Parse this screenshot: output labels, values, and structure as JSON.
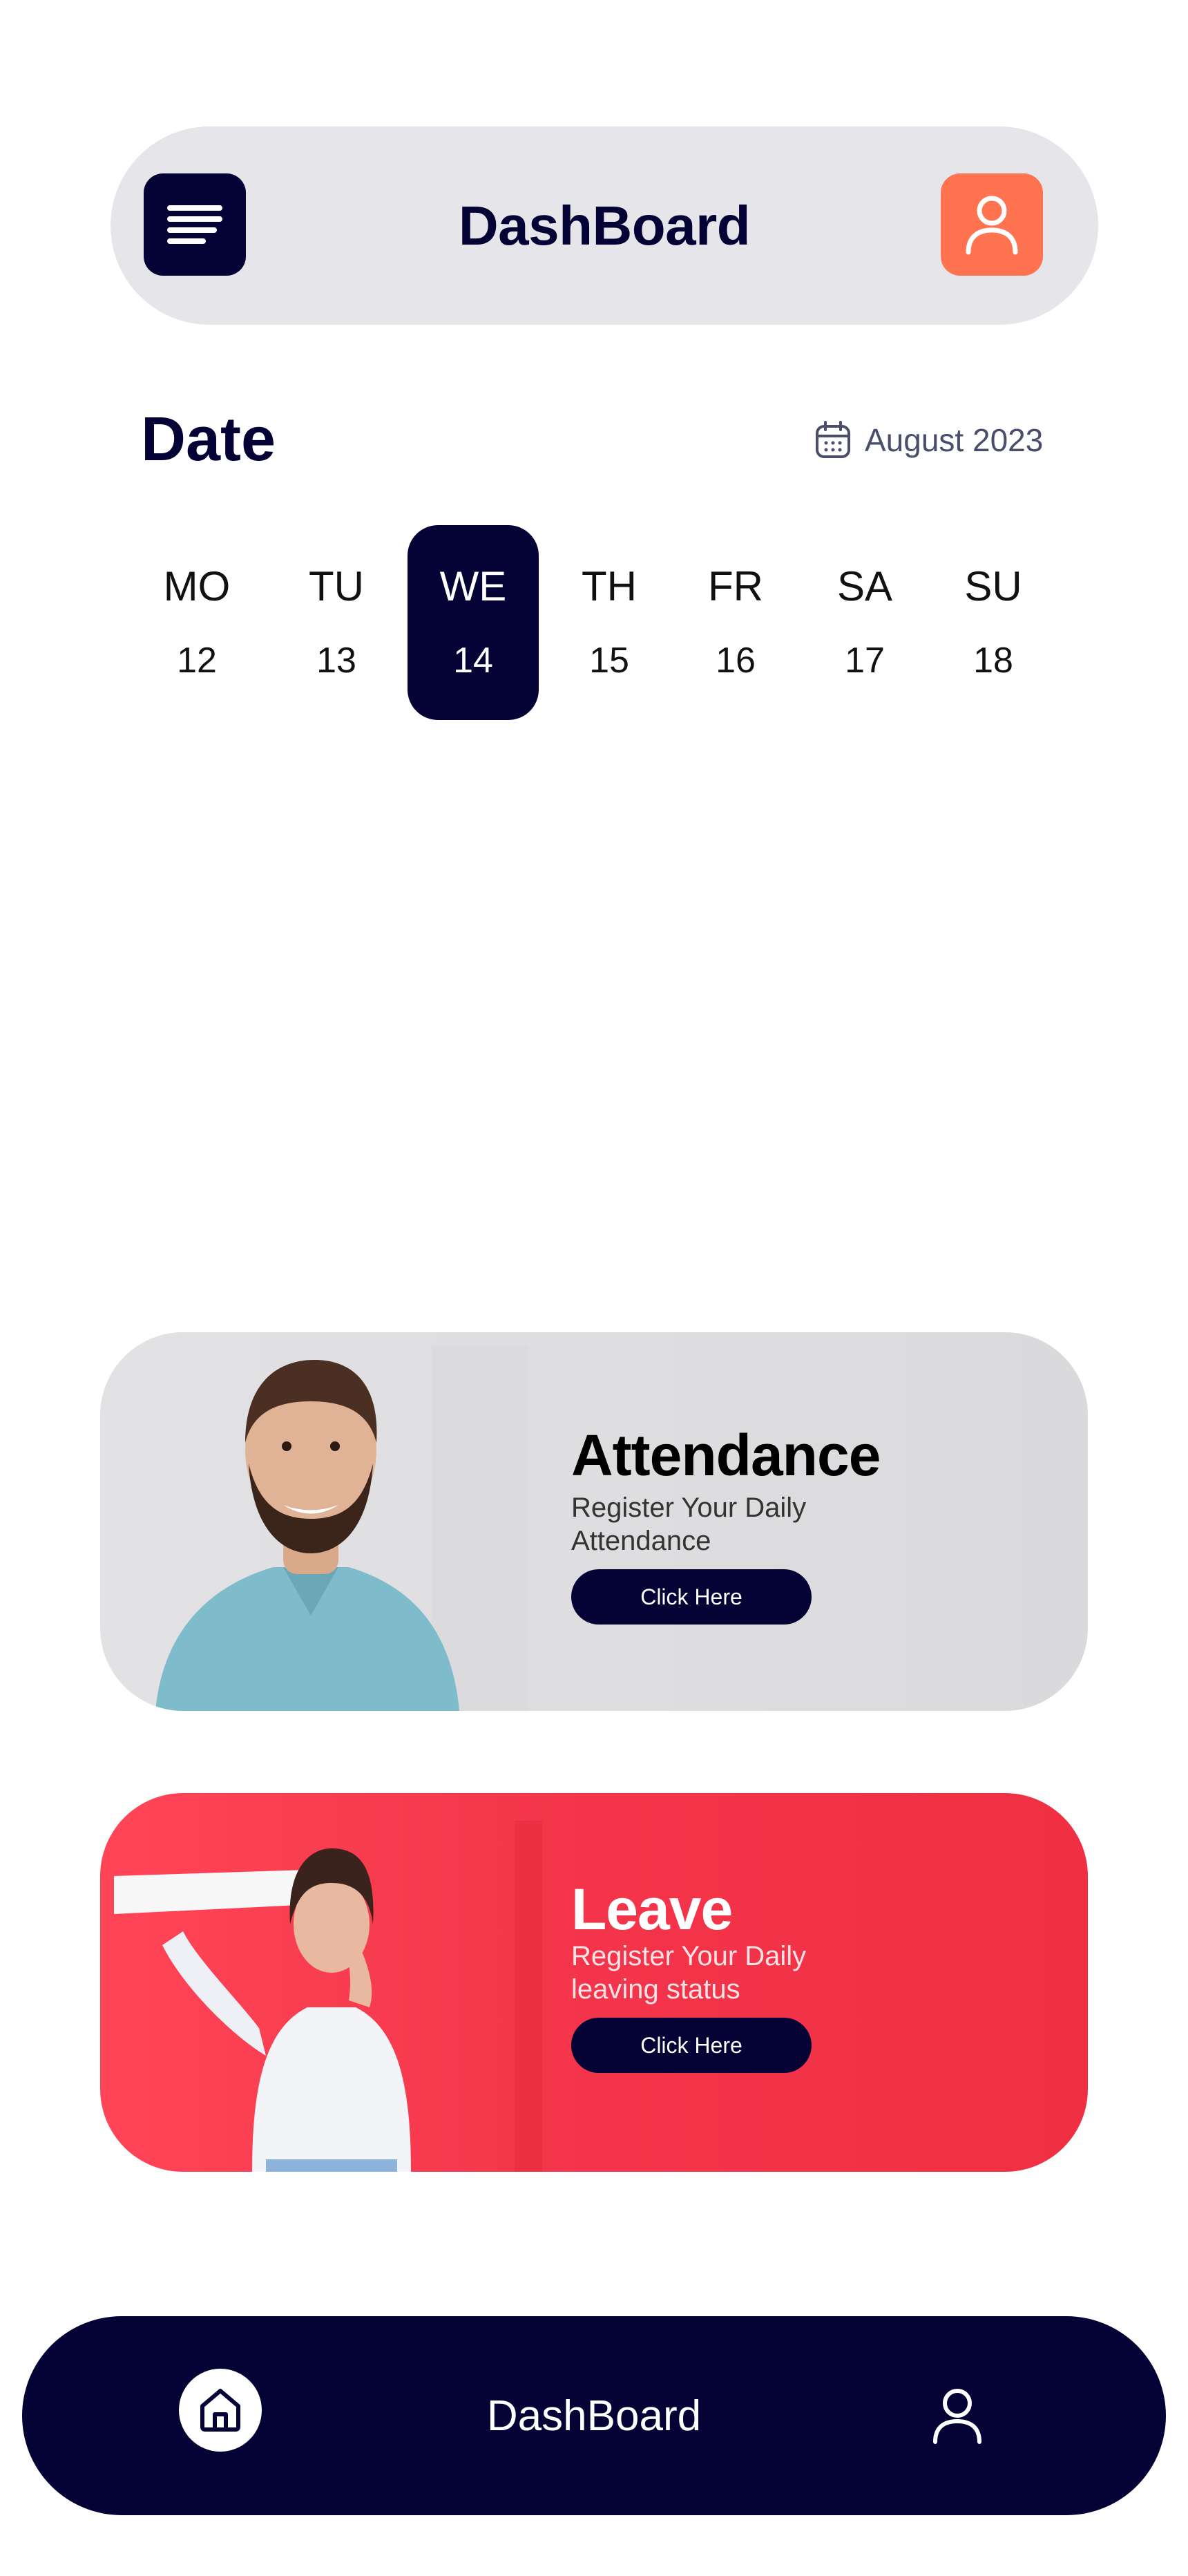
{
  "header": {
    "title": "DashBoard"
  },
  "date_section": {
    "label": "Date",
    "month": "August 2023",
    "days": [
      {
        "name": "MO",
        "num": "12",
        "active": false
      },
      {
        "name": "TU",
        "num": "13",
        "active": false
      },
      {
        "name": "WE",
        "num": "14",
        "active": true
      },
      {
        "name": "TH",
        "num": "15",
        "active": false
      },
      {
        "name": "FR",
        "num": "16",
        "active": false
      },
      {
        "name": "SA",
        "num": "17",
        "active": false
      },
      {
        "name": "SU",
        "num": "18",
        "active": false
      }
    ]
  },
  "cards": [
    {
      "title": "Attendance",
      "subtitle": "Register Your Daily Attendance",
      "button": "Click Here"
    },
    {
      "title": "Leave",
      "subtitle": "Register Your Daily leaving status",
      "button": "Click Here"
    }
  ],
  "bottom_nav": {
    "label": "DashBoard"
  },
  "icons": {
    "menu": "menu-icon",
    "profile": "user-icon",
    "calendar": "calendar-icon",
    "home": "home-icon"
  },
  "colors": {
    "navy": "#050335",
    "accent_orange": "#ff7350",
    "leave_red": "#f3344a",
    "header_gray": "#e6e6ea"
  }
}
